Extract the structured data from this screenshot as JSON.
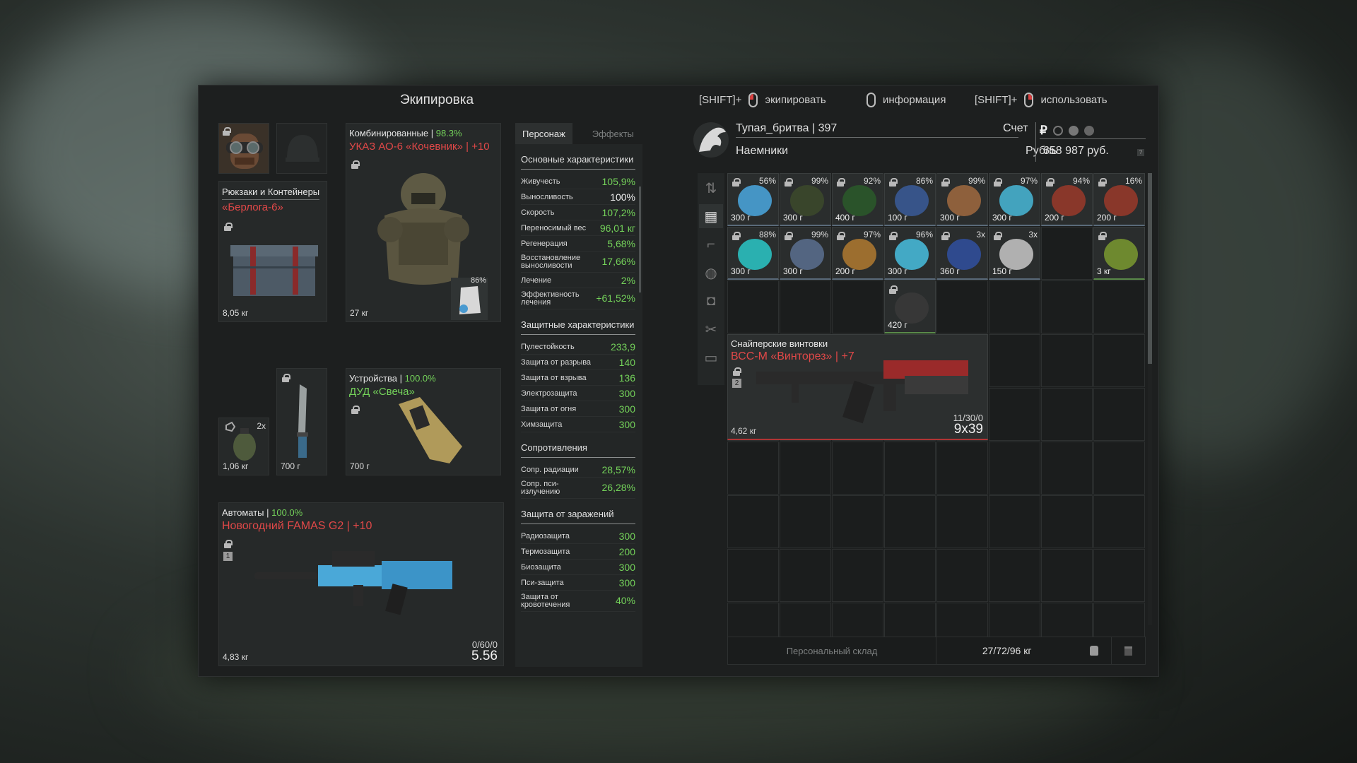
{
  "header": {
    "title": "Экипировка",
    "hints": [
      {
        "prefix": "[SHIFT]+",
        "label": "экипировать"
      },
      {
        "prefix": "",
        "label": "информация"
      },
      {
        "prefix": "[SHIFT]+",
        "label": "использовать"
      }
    ]
  },
  "equipment": {
    "backpack": {
      "category": "Рюкзаки и Контейнеры",
      "name": "«Берлога-6»",
      "weight": "8,05 кг"
    },
    "armor": {
      "category": "Комбинированные",
      "durability": "98.3%",
      "name": "УКАЗ АО-6 «Кочевник» | +10",
      "weight": "27 кг",
      "plate_pct": "86%"
    },
    "device": {
      "category": "Устройства",
      "durability": "100.0%",
      "name": "ДУД «Свеча»",
      "weight": "700 г"
    },
    "grenade": {
      "count": "2x",
      "weight": "1,06 кг"
    },
    "knife": {
      "weight": "700 г"
    },
    "rifle": {
      "category": "Автоматы",
      "durability": "100.0%",
      "name": "Новогодний FAMAS G2 | +10",
      "weight": "4,83 кг",
      "ammo": "0/60/0",
      "caliber": "5.56",
      "slot_number": "1"
    }
  },
  "stats": {
    "tabs": [
      "Персонаж",
      "Эффекты"
    ],
    "sections": {
      "main": {
        "title": "Основные характеристики",
        "rows": [
          {
            "label": "Живучесть",
            "value": "105,9%"
          },
          {
            "label": "Выносливость",
            "value": "100%"
          },
          {
            "label": "Скорость",
            "value": "107,2%"
          },
          {
            "label": "Переносимый вес",
            "value": "96,01 кг"
          },
          {
            "label": "Регенерация",
            "value": "5,68%"
          },
          {
            "label": "Восстановление выносливости",
            "value": "17,66%"
          },
          {
            "label": "Лечение",
            "value": "2%"
          },
          {
            "label": "Эффективность лечения",
            "value": "+61,52%"
          }
        ]
      },
      "protection": {
        "title": "Защитные характеристики",
        "rows": [
          {
            "label": "Пулестойкость",
            "value": "233,9"
          },
          {
            "label": "Защита от разрыва",
            "value": "140"
          },
          {
            "label": "Защита от взрыва",
            "value": "136"
          },
          {
            "label": "Электрозащита",
            "value": "300"
          },
          {
            "label": "Защита от огня",
            "value": "300"
          },
          {
            "label": "Химзащита",
            "value": "300"
          }
        ]
      },
      "resist": {
        "title": "Сопротивления",
        "rows": [
          {
            "label": "Сопр. радиации",
            "value": "28,57%"
          },
          {
            "label": "Сопр. пси-излучению",
            "value": "26,28%"
          }
        ]
      },
      "infection": {
        "title": "Защита от заражений",
        "rows": [
          {
            "label": "Радиозащита",
            "value": "300"
          },
          {
            "label": "Термозащита",
            "value": "200"
          },
          {
            "label": "Биозащита",
            "value": "300"
          },
          {
            "label": "Пси-защита",
            "value": "300"
          },
          {
            "label": "Защита от кровотечения",
            "value": "40%"
          }
        ]
      }
    }
  },
  "player": {
    "name": "Тупая_бритва | 397",
    "faction": "Наемники",
    "account_label": "Счет",
    "currency_label": "Рубль",
    "balance": "658 987 руб.",
    "currency_symbol": "₽"
  },
  "inventory": {
    "items": [
      {
        "pct": "56%",
        "weight": "300 г",
        "color": "#4aa8e0"
      },
      {
        "pct": "99%",
        "weight": "300 г",
        "color": "#3c4a2c"
      },
      {
        "pct": "92%",
        "weight": "400 г",
        "color": "#2a5a2a"
      },
      {
        "pct": "86%",
        "weight": "100 г",
        "color": "#3a5c9a"
      },
      {
        "pct": "99%",
        "weight": "300 г",
        "color": "#a06a40"
      },
      {
        "pct": "97%",
        "weight": "300 г",
        "color": "#48b8d8"
      },
      {
        "pct": "94%",
        "weight": "200 г",
        "color": "#9a3a2a"
      },
      {
        "pct": "16%",
        "weight": "200 г",
        "color": "#9a3a2a"
      },
      {
        "pct": "88%",
        "weight": "300 г",
        "color": "#2ac8c8"
      },
      {
        "pct": "99%",
        "weight": "300 г",
        "color": "#5a7090"
      },
      {
        "pct": "97%",
        "weight": "200 г",
        "color": "#b07a30"
      },
      {
        "pct": "96%",
        "weight": "300 г",
        "color": "#48c0e0"
      },
      {
        "pct": "3x",
        "weight": "360 г",
        "color": "#3050a0"
      },
      {
        "pct": "3x",
        "weight": "150 г",
        "color": "#c8c8c8"
      },
      {
        "pct": "",
        "weight": "3 кг",
        "color": "#7a9a30"
      },
      {
        "pct": "",
        "weight": "420 г",
        "color": "#3a3a3a"
      }
    ],
    "weapon": {
      "category": "Снайперские винтовки",
      "name": "ВСС-М «Винторез» | +7",
      "weight": "4,62 кг",
      "ammo": "11/30/0",
      "caliber": "9x39",
      "slot_number": "2"
    },
    "footer": {
      "storage": "Персональный склад",
      "weight": "27/72/96 кг"
    }
  }
}
